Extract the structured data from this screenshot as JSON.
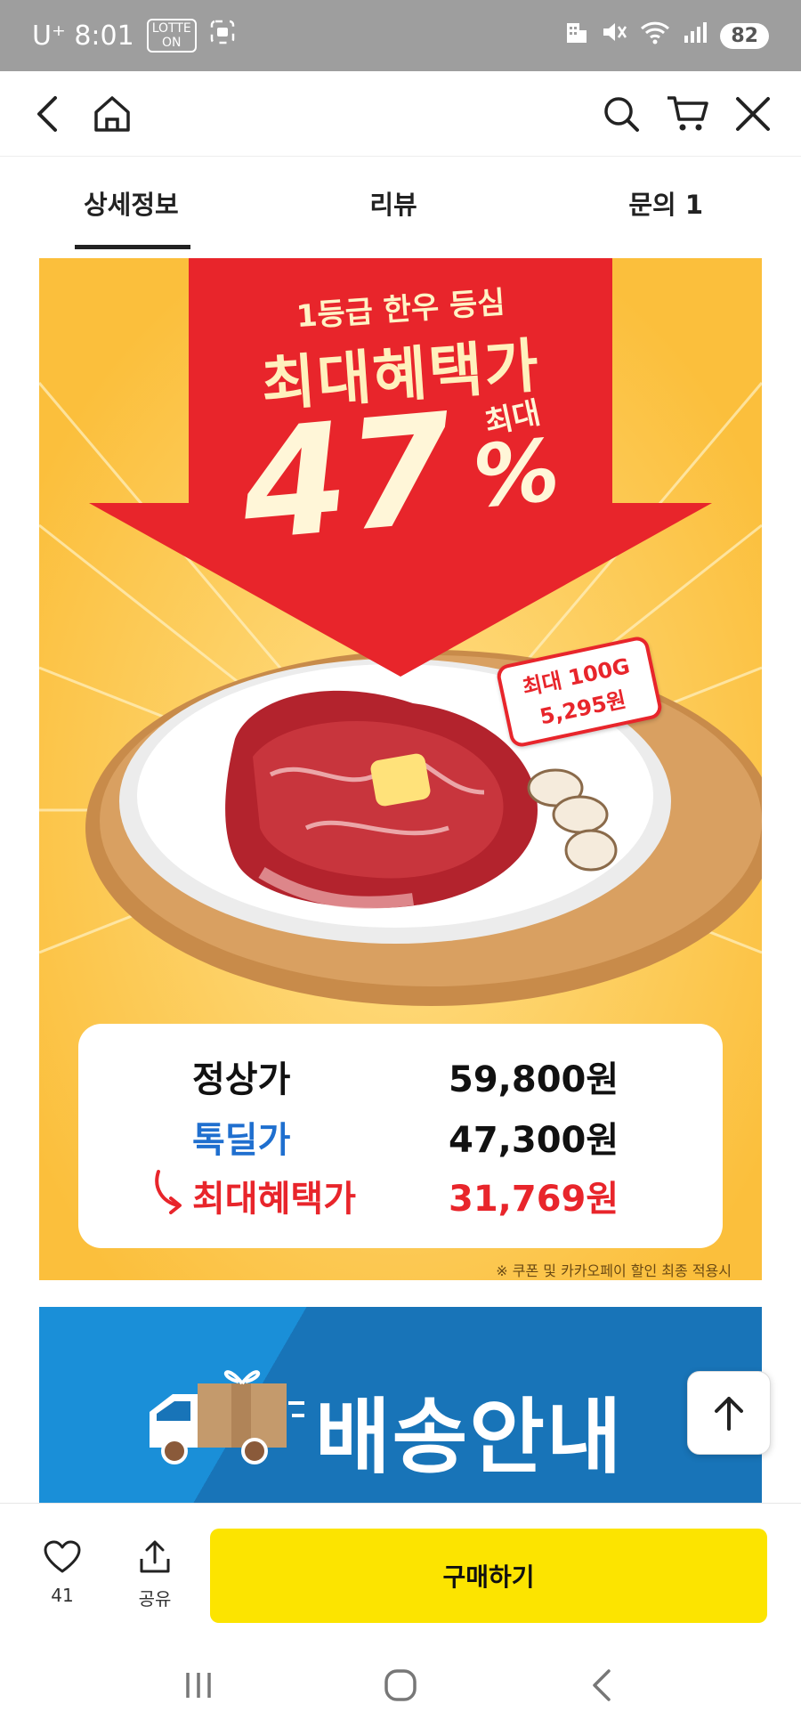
{
  "status_bar": {
    "carrier_time": "U⁺ 8:01",
    "badge": "ON",
    "battery": "82"
  },
  "tabs": [
    {
      "label": "상세정보",
      "active": true
    },
    {
      "label": "리뷰",
      "active": false
    },
    {
      "label": "문의 1",
      "active": false
    }
  ],
  "promo": {
    "subtitle": "1등급 한우 등심",
    "headline": "최대혜택가",
    "max_label": "최대",
    "discount_number": "47",
    "percent_sign": "%",
    "tag_line1": "최대 100G",
    "tag_line2": "5,295원",
    "prices": [
      {
        "label": "정상가",
        "value": "59,800원"
      },
      {
        "label": "톡딜가",
        "value": "47,300원"
      },
      {
        "label": "최대혜택가",
        "value": "31,769원"
      }
    ],
    "footnote": "※ 쿠폰 및 카카오페이 할인 최종 적용시"
  },
  "delivery": {
    "title": "배송안내"
  },
  "action_bar": {
    "like_count": "41",
    "share_label": "공유",
    "buy_label": "구매하기"
  },
  "colors": {
    "accent_yellow": "#fce400",
    "promo_bg": "#fcc64a",
    "promo_red": "#e8252b",
    "promo_blue": "#1f6fcf",
    "delivery_blue": "#1874b8"
  }
}
